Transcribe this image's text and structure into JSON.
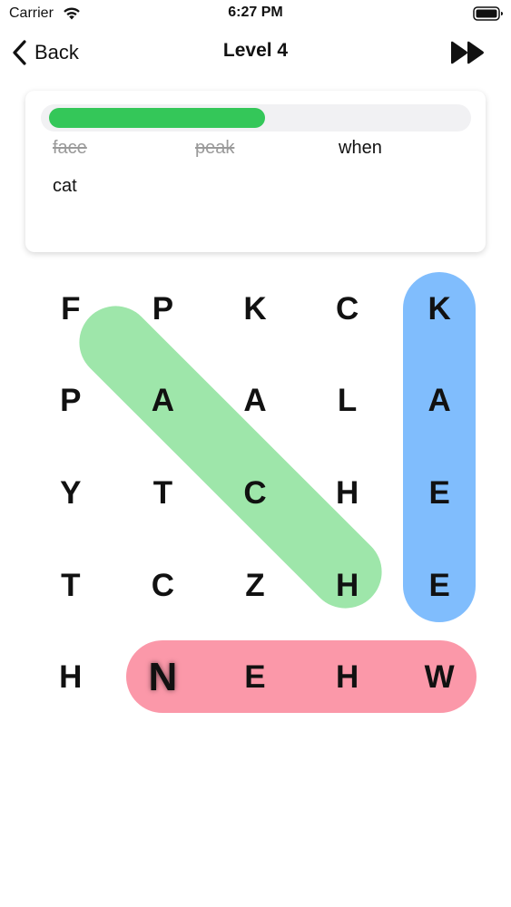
{
  "status_bar": {
    "carrier": "Carrier",
    "time": "6:27 PM",
    "icons": [
      "wifi-icon",
      "battery-icon"
    ]
  },
  "nav": {
    "back_label": "Back",
    "title": "Level 4",
    "back_icon": "chevron-left-icon",
    "skip_icon": "fast-forward-icon"
  },
  "progress": {
    "fraction": 0.5,
    "color": "#34c759"
  },
  "words": [
    {
      "text": "face",
      "found": true
    },
    {
      "text": "peak",
      "found": true
    },
    {
      "text": "when",
      "found": false
    },
    {
      "text": "cat",
      "found": false
    }
  ],
  "grid": {
    "rows": [
      [
        "F",
        "P",
        "K",
        "C",
        "K"
      ],
      [
        "P",
        "A",
        "A",
        "L",
        "A"
      ],
      [
        "Y",
        "T",
        "C",
        "H",
        "E"
      ],
      [
        "T",
        "C",
        "Z",
        "H",
        "E"
      ],
      [
        "H",
        "N",
        "E",
        "H",
        "W"
      ]
    ],
    "active_cell": "N",
    "highlight_colors": {
      "face": "#9ee6aa",
      "peak": "#80bdfd",
      "when": "#fb98a9"
    }
  }
}
